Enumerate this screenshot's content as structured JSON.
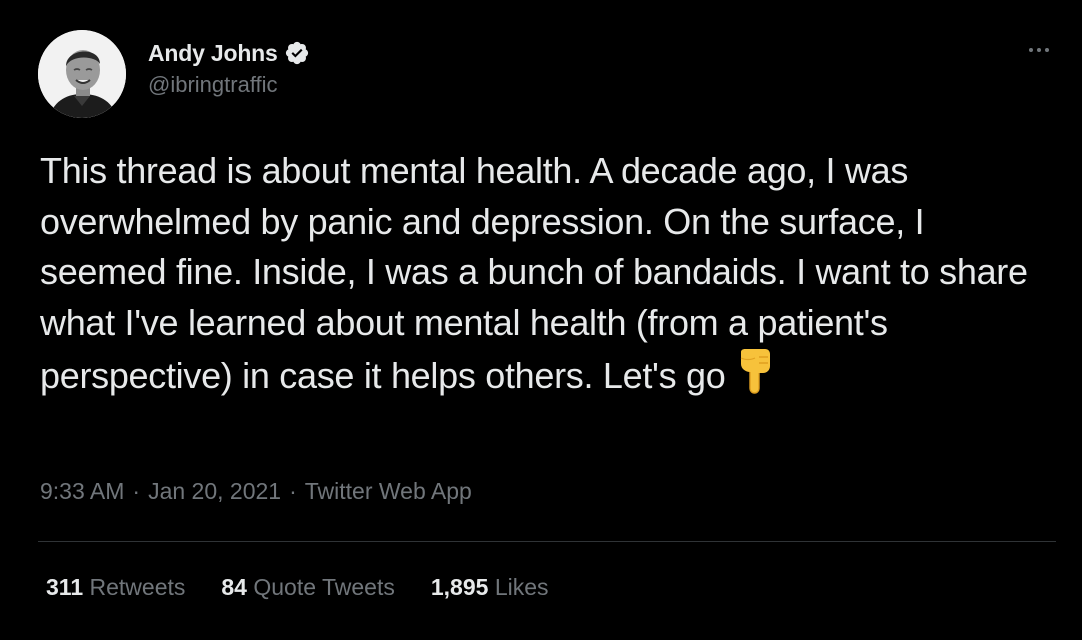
{
  "author": {
    "display_name": "Andy Johns",
    "handle": "@ibringtraffic",
    "verified": true,
    "verified_color": "#e7e9ea"
  },
  "tweet": {
    "text": "This thread is about mental health. A decade ago, I was overwhelmed by panic and depression. On the surface, I seemed fine. Inside, I was a bunch of bandaids. I want to share what I've learned about mental health (from a patient's perspective) in case it helps others. Let's go",
    "emoji": "backhand-index-pointing-down",
    "time": "9:33 AM",
    "separator": "·",
    "date": "Jan 20, 2021",
    "source": "Twitter Web App"
  },
  "stats": {
    "retweets": {
      "count": "311",
      "label": "Retweets"
    },
    "quote_tweets": {
      "count": "84",
      "label": "Quote Tweets"
    },
    "likes": {
      "count": "1,895",
      "label": "Likes"
    }
  },
  "colors": {
    "background": "#000000",
    "text": "#e7e9ea",
    "secondary": "#71767b",
    "divider": "#2f3336",
    "emoji": "#f7c23b"
  },
  "icons": {
    "more": "more-horizontal-icon",
    "verified": "verified-badge-icon"
  }
}
